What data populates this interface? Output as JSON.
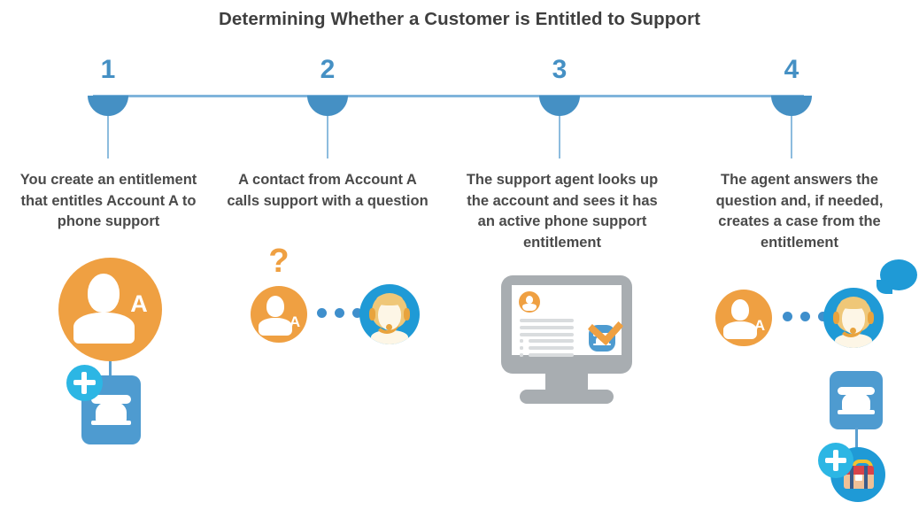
{
  "page": {
    "title": "Determining Whether a Customer is Entitled to Support",
    "background": "#ffffff"
  },
  "colors": {
    "orange": "#efa042",
    "blue": "#4e9bd0",
    "blue_bright": "#1f9ad6",
    "cyan": "#2cb6e4",
    "timeline": "#4590c4",
    "timeline_rule": "#7fb4db",
    "text": "#4a4a4a",
    "title_text": "#3f3f3f",
    "monitor_gray": "#a8adb1",
    "screen_line_gray": "#d9dcde",
    "case_red": "#d8434a",
    "case_tan": "#f0c096",
    "case_handle": "#f2c230"
  },
  "steps": [
    {
      "number": "1",
      "caption": "You create an entitlement that entitles Account A to phone support",
      "icons": [
        {
          "name": "account-avatar-icon",
          "label": "A"
        },
        {
          "name": "phone-entitlement-icon"
        },
        {
          "name": "plus-badge-icon",
          "glyph": "+"
        }
      ]
    },
    {
      "number": "2",
      "caption": "A contact from Account A calls support with a question",
      "icons": [
        {
          "name": "question-mark-icon",
          "glyph": "?"
        },
        {
          "name": "account-avatar-icon",
          "label": "A"
        },
        {
          "name": "dots-icon"
        },
        {
          "name": "support-agent-icon"
        }
      ]
    },
    {
      "number": "3",
      "caption": "The support agent looks up the account and sees it has an active phone support entitlement",
      "icons": [
        {
          "name": "monitor-icon"
        },
        {
          "name": "account-record-avatar-icon"
        },
        {
          "name": "phone-entitlement-icon"
        },
        {
          "name": "checkmark-icon"
        }
      ]
    },
    {
      "number": "4",
      "caption": "The agent answers the question and, if needed, creates a case from the entitlement",
      "icons": [
        {
          "name": "account-avatar-icon",
          "label": "A"
        },
        {
          "name": "dots-icon"
        },
        {
          "name": "support-agent-icon"
        },
        {
          "name": "speech-bubble-icon"
        },
        {
          "name": "phone-entitlement-icon"
        },
        {
          "name": "plus-badge-icon",
          "glyph": "+"
        },
        {
          "name": "case-briefcase-icon"
        }
      ]
    }
  ]
}
